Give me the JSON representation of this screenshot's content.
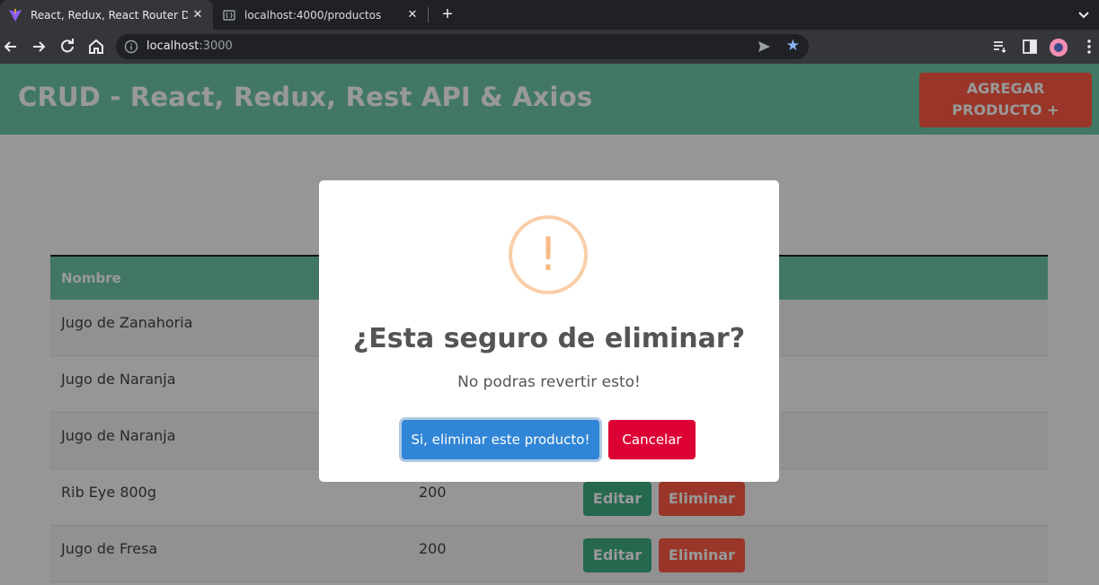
{
  "browser": {
    "tabs": [
      {
        "title": "React, Redux, React Router DOM",
        "icon": "vite-icon"
      },
      {
        "title": "localhost:4000/productos",
        "icon": "json-icon"
      }
    ],
    "url_host": "localhost",
    "url_port": ":3000"
  },
  "header": {
    "title": "CRUD - React, Redux, Rest API & Axios",
    "add_button": "AGREGAR PRODUCTO +"
  },
  "table": {
    "columns": [
      "Nombre"
    ],
    "rows": [
      {
        "nombre": "Jugo de Zanahoria",
        "precio": ""
      },
      {
        "nombre": "Jugo de Naranja",
        "precio": ""
      },
      {
        "nombre": "Jugo de Naranja",
        "precio": ""
      },
      {
        "nombre": "Rib Eye 800g",
        "precio": "200"
      },
      {
        "nombre": "Jugo de Fresa",
        "precio": "200"
      }
    ],
    "edit_label": "Editar",
    "delete_label": "Eliminar"
  },
  "modal": {
    "icon": "!",
    "title": "¿Esta seguro de eliminar?",
    "text": "No podras revertir esto!",
    "confirm_label": "Si, eliminar este producto!",
    "cancel_label": "Cancelar"
  },
  "colors": {
    "header_bg": "#6fc7a8",
    "add_button_bg": "#ff5b45",
    "edit_bg": "#3fae82",
    "delete_bg": "#ff5b45",
    "confirm_bg": "#3085d6",
    "cancel_bg": "#dd0034",
    "warning": "#f8bb86"
  }
}
